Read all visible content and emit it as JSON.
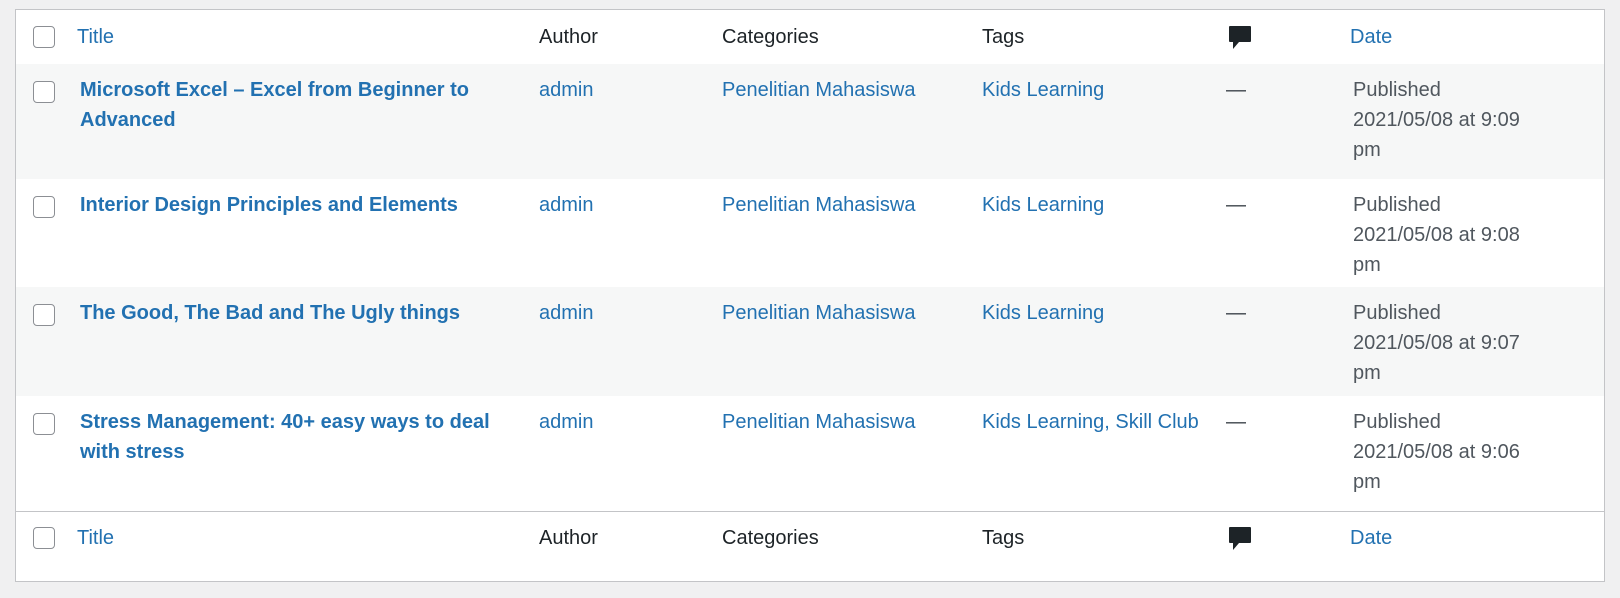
{
  "columns": {
    "title": "Title",
    "author": "Author",
    "categories": "Categories",
    "tags": "Tags",
    "comments_icon": "comment-icon",
    "date": "Date"
  },
  "rows": [
    {
      "title_line1": "Microsoft Excel – Excel from Beginner to",
      "title_line2": "Advanced",
      "author": "admin",
      "category": "Penelitian Mahasiswa",
      "tags": "Kids Learning",
      "comments": "—",
      "status": "Published",
      "date": "2021/05/08 at 9:09",
      "date_suffix": "pm"
    },
    {
      "title_line1": "Interior Design Principles and Elements",
      "title_line2": "",
      "author": "admin",
      "category": "Penelitian Mahasiswa",
      "tags": "Kids Learning",
      "comments": "—",
      "status": "Published",
      "date": "2021/05/08 at 9:08",
      "date_suffix": "pm"
    },
    {
      "title_line1": "The Good, The Bad and The Ugly things",
      "title_line2": "",
      "author": "admin",
      "category": "Penelitian Mahasiswa",
      "tags": "Kids Learning",
      "comments": "—",
      "status": "Published",
      "date": "2021/05/08 at 9:07",
      "date_suffix": "pm"
    },
    {
      "title_line1": "Stress Management: 40+ easy ways to deal",
      "title_line2": "with stress",
      "author": "admin",
      "category": "Penelitian Mahasiswa",
      "tags": "Kids Learning, Skill Club",
      "comments": "—",
      "status": "Published",
      "date": "2021/05/08 at 9:06",
      "date_suffix": "pm"
    }
  ],
  "colors": {
    "link": "#2271b1",
    "alt_row": "#f6f7f7",
    "border": "#c3c4c7",
    "page_bg": "#f0f0f1"
  }
}
